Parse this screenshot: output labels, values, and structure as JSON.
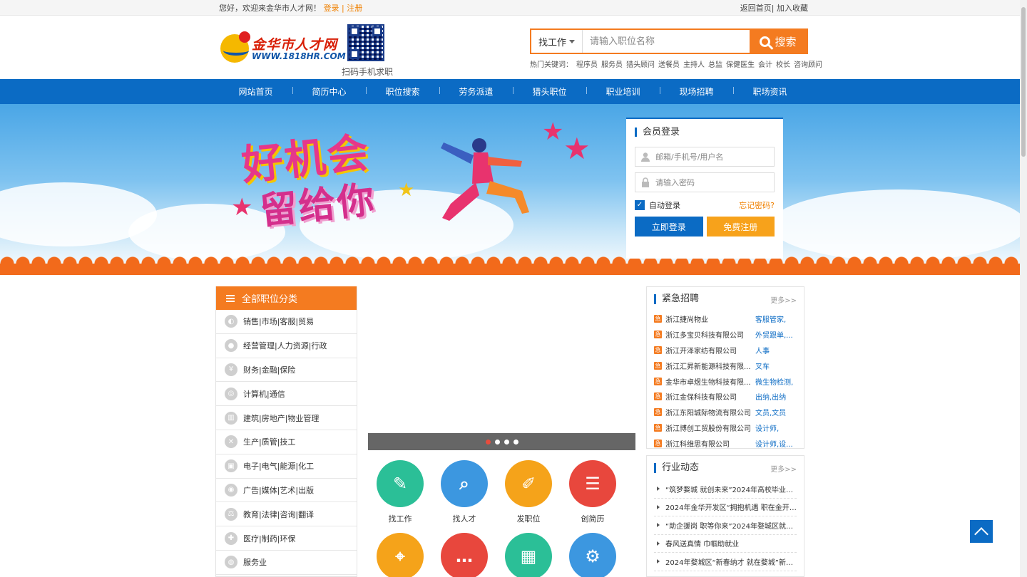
{
  "topbar": {
    "welcome": "您好，欢迎来金华市人才网！",
    "login": "登录",
    "sep": "|",
    "register": "注册",
    "home": "返回首页|",
    "favorite": "加入收藏"
  },
  "logo": {
    "name": "金华市人才网",
    "url": "WWW.1818HR.COM"
  },
  "qr": {
    "caption": "扫码手机求职"
  },
  "search": {
    "type": "找工作",
    "placeholder": "请输入职位名称",
    "button": "搜索"
  },
  "hotwords": {
    "label": "热门关键词：",
    "items": [
      "程序员",
      "服务员",
      "猎头顾问",
      "送餐员",
      "主持人",
      "总监",
      "保健医生",
      "会计",
      "校长",
      "咨询顾问"
    ]
  },
  "nav": [
    "网站首页",
    "简历中心",
    "职位搜索",
    "劳务派遣",
    "猎头职位",
    "职业培训",
    "现场招聘",
    "职场资讯"
  ],
  "banner": {
    "line1": "好机会",
    "line2": "留给你"
  },
  "login": {
    "title": "会员登录",
    "user_placeholder": "邮箱/手机号/用户名",
    "pass_placeholder": "请输入密码",
    "auto": "自动登录",
    "forgot": "忘记密码?",
    "login_btn": "立即登录",
    "register_btn": "免费注册"
  },
  "categories": {
    "title": "全部职位分类",
    "items": [
      "销售|市场|客服|贸易",
      "经营管理|人力资源|行政",
      "财务|金融|保险",
      "计算机|通信",
      "建筑|房地产|物业管理",
      "生产|质管|技工",
      "电子|电气|能源|化工",
      "广告|媒体|艺术|出版",
      "教育|法律|咨询|翻译",
      "医疗|制药|环保",
      "服务业"
    ]
  },
  "quick": [
    {
      "label": "找工作",
      "color": "#2bbf97"
    },
    {
      "label": "找人才",
      "color": "#3c97e0"
    },
    {
      "label": "发职位",
      "color": "#f5a31a"
    },
    {
      "label": "创简历",
      "color": "#e8473d"
    },
    {
      "label": "",
      "color": "#f5a31a"
    },
    {
      "label": "",
      "color": "#e8473d"
    },
    {
      "label": "",
      "color": "#2bbf97"
    },
    {
      "label": "",
      "color": "#3c97e0"
    }
  ],
  "urgent": {
    "title": "紧急招聘",
    "more": "更多>>",
    "items": [
      {
        "company": "浙江捷尚物业",
        "job": "客服管家,"
      },
      {
        "company": "浙江多宝贝科技有限公司",
        "job": "外贸跟单,..."
      },
      {
        "company": "浙江开泽家纺有限公司",
        "job": "人事"
      },
      {
        "company": "浙江汇昇新能源科技有限...",
        "job": "叉车"
      },
      {
        "company": "金华市卓煜生物科技有限...",
        "job": "微生物检测,"
      },
      {
        "company": "浙江金保科技有限公司",
        "job": "出纳,出纳"
      },
      {
        "company": "浙江东阳城际物流有限公司",
        "job": "文员,文员"
      },
      {
        "company": "浙江博创工贸股份有限公司",
        "job": "设计师,"
      },
      {
        "company": "浙江科维思有限公司",
        "job": "设计师,设..."
      }
    ]
  },
  "news": {
    "title": "行业动态",
    "more": "更多>>",
    "items": [
      "“筑梦婺城 就创未来”2024年高校毕业生就...",
      "2024年金华开发区“拥抱机遇 职在金开”招...",
      "“助企援岗 职等你来”2024年婺城区就业专...",
      "春风送真情 巾帼助就业",
      "2024年婺城区“新春纳才 就在婺城”新春大..."
    ]
  }
}
